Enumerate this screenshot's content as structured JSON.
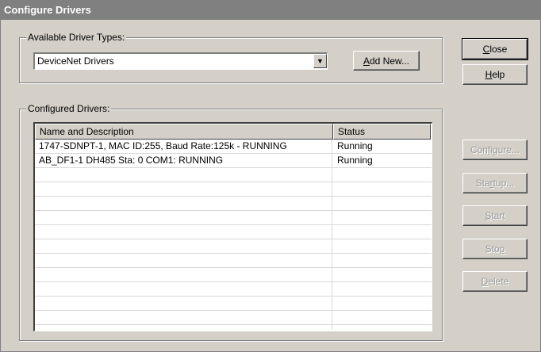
{
  "window": {
    "title": "Configure Drivers"
  },
  "available_group": {
    "label": "Available Driver Types:",
    "selected_value": "DeviceNet Drivers",
    "add_new_label": "Add New..."
  },
  "configured_group": {
    "label": "Configured Drivers:",
    "columns": [
      "Name and Description",
      "Status"
    ],
    "rows": [
      {
        "name": "1747-SDNPT-1, MAC ID:255, Baud Rate:125k - RUNNING",
        "status": "Running"
      },
      {
        "name": "AB_DF1-1 DH485 Sta: 0 COM1: RUNNING",
        "status": "Running"
      }
    ]
  },
  "buttons": {
    "close": "Close",
    "help": "Help",
    "configure": "Configure...",
    "startup": "Startup...",
    "start": "Start",
    "stop": "Stop",
    "delete": "Delete"
  },
  "colors": {
    "title_bar": "#808080",
    "dialog_face": "#d4d0c8",
    "disabled_text": "#9a9a9a"
  }
}
